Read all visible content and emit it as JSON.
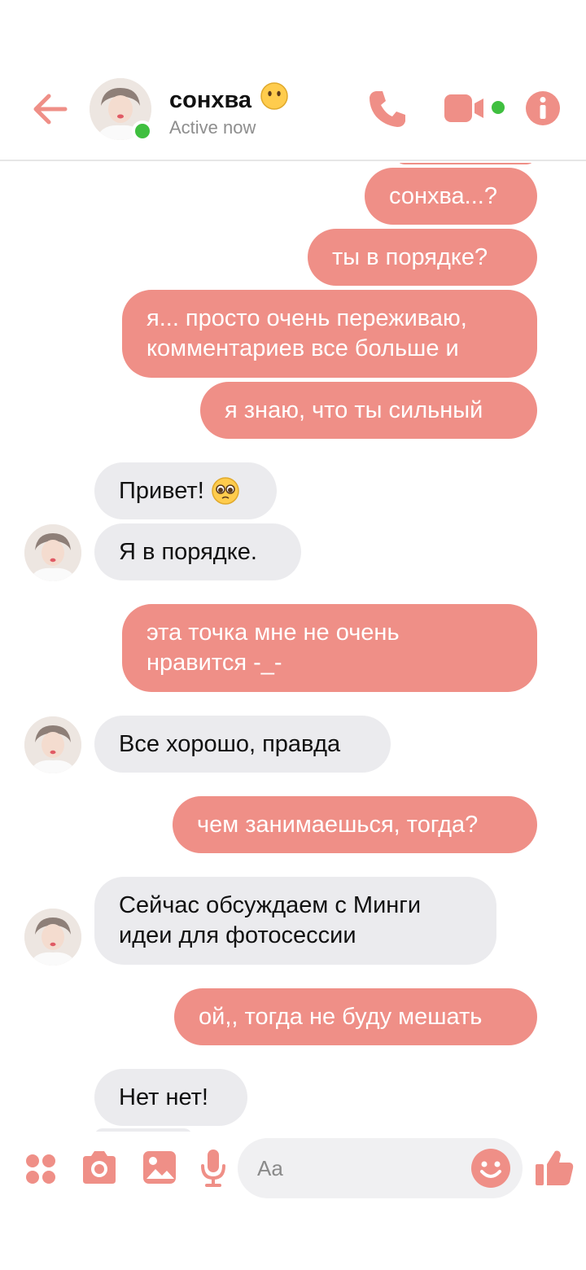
{
  "header": {
    "contact_name": "сонхва",
    "status": "Active now",
    "accent_color": "#ef8f87",
    "online_color": "#3fbf3f"
  },
  "messages": [
    {
      "side": "out",
      "text": "сонхва...?"
    },
    {
      "side": "out",
      "text": "ты в порядке?"
    },
    {
      "side": "out",
      "text": "я... просто очень переживаю, комментариев все больше и"
    },
    {
      "side": "out",
      "text": "я знаю, что ты сильный"
    },
    {
      "side": "in",
      "text": "Привет!"
    },
    {
      "side": "in",
      "text": "Я в порядке."
    },
    {
      "side": "out",
      "text": "эта точка мне не очень нравится -_-"
    },
    {
      "side": "in",
      "text": "Все хорошо, правда"
    },
    {
      "side": "out",
      "text": "чем занимаешься, тогда?"
    },
    {
      "side": "in",
      "text": "Сейчас обсуждаем с Минги идеи для фотосессии"
    },
    {
      "side": "out",
      "text": "ой,, тогда не буду мешать"
    },
    {
      "side": "in",
      "text": "Нет нет!"
    }
  ],
  "composer": {
    "placeholder": "Aa"
  },
  "icons": {
    "back": "back-arrow-icon",
    "call": "phone-icon",
    "video": "video-camera-icon",
    "info": "info-icon",
    "apps": "apps-grid-icon",
    "camera": "camera-icon",
    "gallery": "image-icon",
    "mic": "microphone-icon",
    "emoji": "smiley-icon",
    "like": "thumbs-up-icon"
  }
}
